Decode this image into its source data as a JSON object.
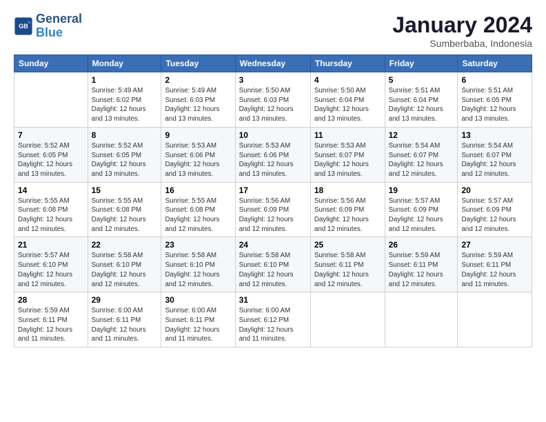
{
  "header": {
    "logo_line1": "General",
    "logo_line2": "Blue",
    "month": "January 2024",
    "location": "Sumberbaba, Indonesia"
  },
  "days_of_week": [
    "Sunday",
    "Monday",
    "Tuesday",
    "Wednesday",
    "Thursday",
    "Friday",
    "Saturday"
  ],
  "weeks": [
    [
      {
        "day": "",
        "info": ""
      },
      {
        "day": "1",
        "info": "Sunrise: 5:49 AM\nSunset: 6:02 PM\nDaylight: 12 hours\nand 13 minutes."
      },
      {
        "day": "2",
        "info": "Sunrise: 5:49 AM\nSunset: 6:03 PM\nDaylight: 12 hours\nand 13 minutes."
      },
      {
        "day": "3",
        "info": "Sunrise: 5:50 AM\nSunset: 6:03 PM\nDaylight: 12 hours\nand 13 minutes."
      },
      {
        "day": "4",
        "info": "Sunrise: 5:50 AM\nSunset: 6:04 PM\nDaylight: 12 hours\nand 13 minutes."
      },
      {
        "day": "5",
        "info": "Sunrise: 5:51 AM\nSunset: 6:04 PM\nDaylight: 12 hours\nand 13 minutes."
      },
      {
        "day": "6",
        "info": "Sunrise: 5:51 AM\nSunset: 6:05 PM\nDaylight: 12 hours\nand 13 minutes."
      }
    ],
    [
      {
        "day": "7",
        "info": "Sunrise: 5:52 AM\nSunset: 6:05 PM\nDaylight: 12 hours\nand 13 minutes."
      },
      {
        "day": "8",
        "info": "Sunrise: 5:52 AM\nSunset: 6:05 PM\nDaylight: 12 hours\nand 13 minutes."
      },
      {
        "day": "9",
        "info": "Sunrise: 5:53 AM\nSunset: 6:06 PM\nDaylight: 12 hours\nand 13 minutes."
      },
      {
        "day": "10",
        "info": "Sunrise: 5:53 AM\nSunset: 6:06 PM\nDaylight: 12 hours\nand 13 minutes."
      },
      {
        "day": "11",
        "info": "Sunrise: 5:53 AM\nSunset: 6:07 PM\nDaylight: 12 hours\nand 13 minutes."
      },
      {
        "day": "12",
        "info": "Sunrise: 5:54 AM\nSunset: 6:07 PM\nDaylight: 12 hours\nand 12 minutes."
      },
      {
        "day": "13",
        "info": "Sunrise: 5:54 AM\nSunset: 6:07 PM\nDaylight: 12 hours\nand 12 minutes."
      }
    ],
    [
      {
        "day": "14",
        "info": "Sunrise: 5:55 AM\nSunset: 6:08 PM\nDaylight: 12 hours\nand 12 minutes."
      },
      {
        "day": "15",
        "info": "Sunrise: 5:55 AM\nSunset: 6:08 PM\nDaylight: 12 hours\nand 12 minutes."
      },
      {
        "day": "16",
        "info": "Sunrise: 5:55 AM\nSunset: 6:08 PM\nDaylight: 12 hours\nand 12 minutes."
      },
      {
        "day": "17",
        "info": "Sunrise: 5:56 AM\nSunset: 6:09 PM\nDaylight: 12 hours\nand 12 minutes."
      },
      {
        "day": "18",
        "info": "Sunrise: 5:56 AM\nSunset: 6:09 PM\nDaylight: 12 hours\nand 12 minutes."
      },
      {
        "day": "19",
        "info": "Sunrise: 5:57 AM\nSunset: 6:09 PM\nDaylight: 12 hours\nand 12 minutes."
      },
      {
        "day": "20",
        "info": "Sunrise: 5:57 AM\nSunset: 6:09 PM\nDaylight: 12 hours\nand 12 minutes."
      }
    ],
    [
      {
        "day": "21",
        "info": "Sunrise: 5:57 AM\nSunset: 6:10 PM\nDaylight: 12 hours\nand 12 minutes."
      },
      {
        "day": "22",
        "info": "Sunrise: 5:58 AM\nSunset: 6:10 PM\nDaylight: 12 hours\nand 12 minutes."
      },
      {
        "day": "23",
        "info": "Sunrise: 5:58 AM\nSunset: 6:10 PM\nDaylight: 12 hours\nand 12 minutes."
      },
      {
        "day": "24",
        "info": "Sunrise: 5:58 AM\nSunset: 6:10 PM\nDaylight: 12 hours\nand 12 minutes."
      },
      {
        "day": "25",
        "info": "Sunrise: 5:58 AM\nSunset: 6:11 PM\nDaylight: 12 hours\nand 12 minutes."
      },
      {
        "day": "26",
        "info": "Sunrise: 5:59 AM\nSunset: 6:11 PM\nDaylight: 12 hours\nand 12 minutes."
      },
      {
        "day": "27",
        "info": "Sunrise: 5:59 AM\nSunset: 6:11 PM\nDaylight: 12 hours\nand 11 minutes."
      }
    ],
    [
      {
        "day": "28",
        "info": "Sunrise: 5:59 AM\nSunset: 6:11 PM\nDaylight: 12 hours\nand 11 minutes."
      },
      {
        "day": "29",
        "info": "Sunrise: 6:00 AM\nSunset: 6:11 PM\nDaylight: 12 hours\nand 11 minutes."
      },
      {
        "day": "30",
        "info": "Sunrise: 6:00 AM\nSunset: 6:11 PM\nDaylight: 12 hours\nand 11 minutes."
      },
      {
        "day": "31",
        "info": "Sunrise: 6:00 AM\nSunset: 6:12 PM\nDaylight: 12 hours\nand 11 minutes."
      },
      {
        "day": "",
        "info": ""
      },
      {
        "day": "",
        "info": ""
      },
      {
        "day": "",
        "info": ""
      }
    ]
  ]
}
